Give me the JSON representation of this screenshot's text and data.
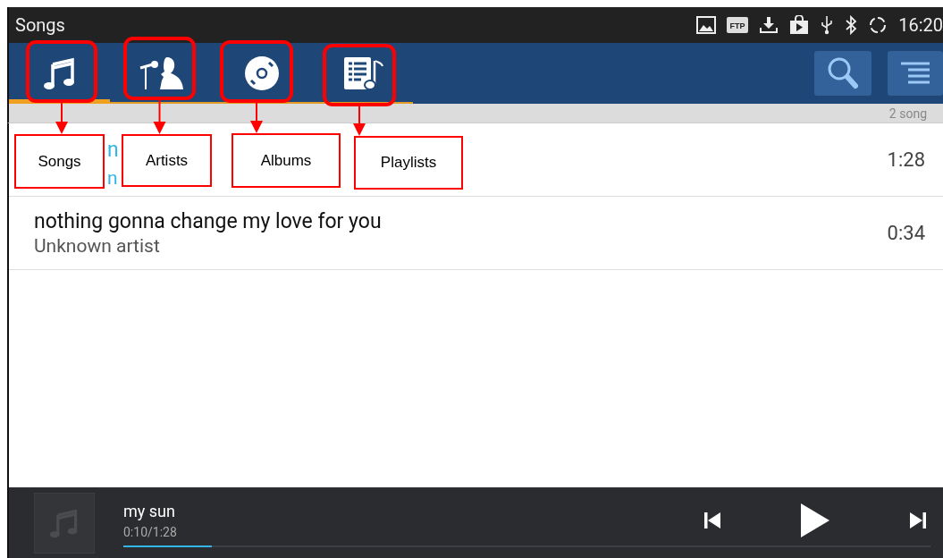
{
  "status_bar": {
    "title": "Songs",
    "ftp": "FTP",
    "time": "16:20"
  },
  "tabs": [
    {
      "kind": "songs",
      "selected": true
    },
    {
      "kind": "artists",
      "selected": false
    },
    {
      "kind": "albums",
      "selected": false
    },
    {
      "kind": "playlists",
      "selected": false
    }
  ],
  "count": "2 song",
  "songs": [
    {
      "title": "n",
      "artist": "n",
      "duration": "1:28",
      "playing": true,
      "covered": true
    },
    {
      "title": "nothing gonna change my love for you",
      "artist": "Unknown artist",
      "duration": "0:34",
      "playing": false,
      "covered": false
    }
  ],
  "player": {
    "title": "my sun",
    "time": "0:10/1:28",
    "level": 0.11
  },
  "annotations": [
    {
      "label": "Songs"
    },
    {
      "label": "Artists"
    },
    {
      "label": "Albums"
    },
    {
      "label": "Playlists"
    }
  ]
}
